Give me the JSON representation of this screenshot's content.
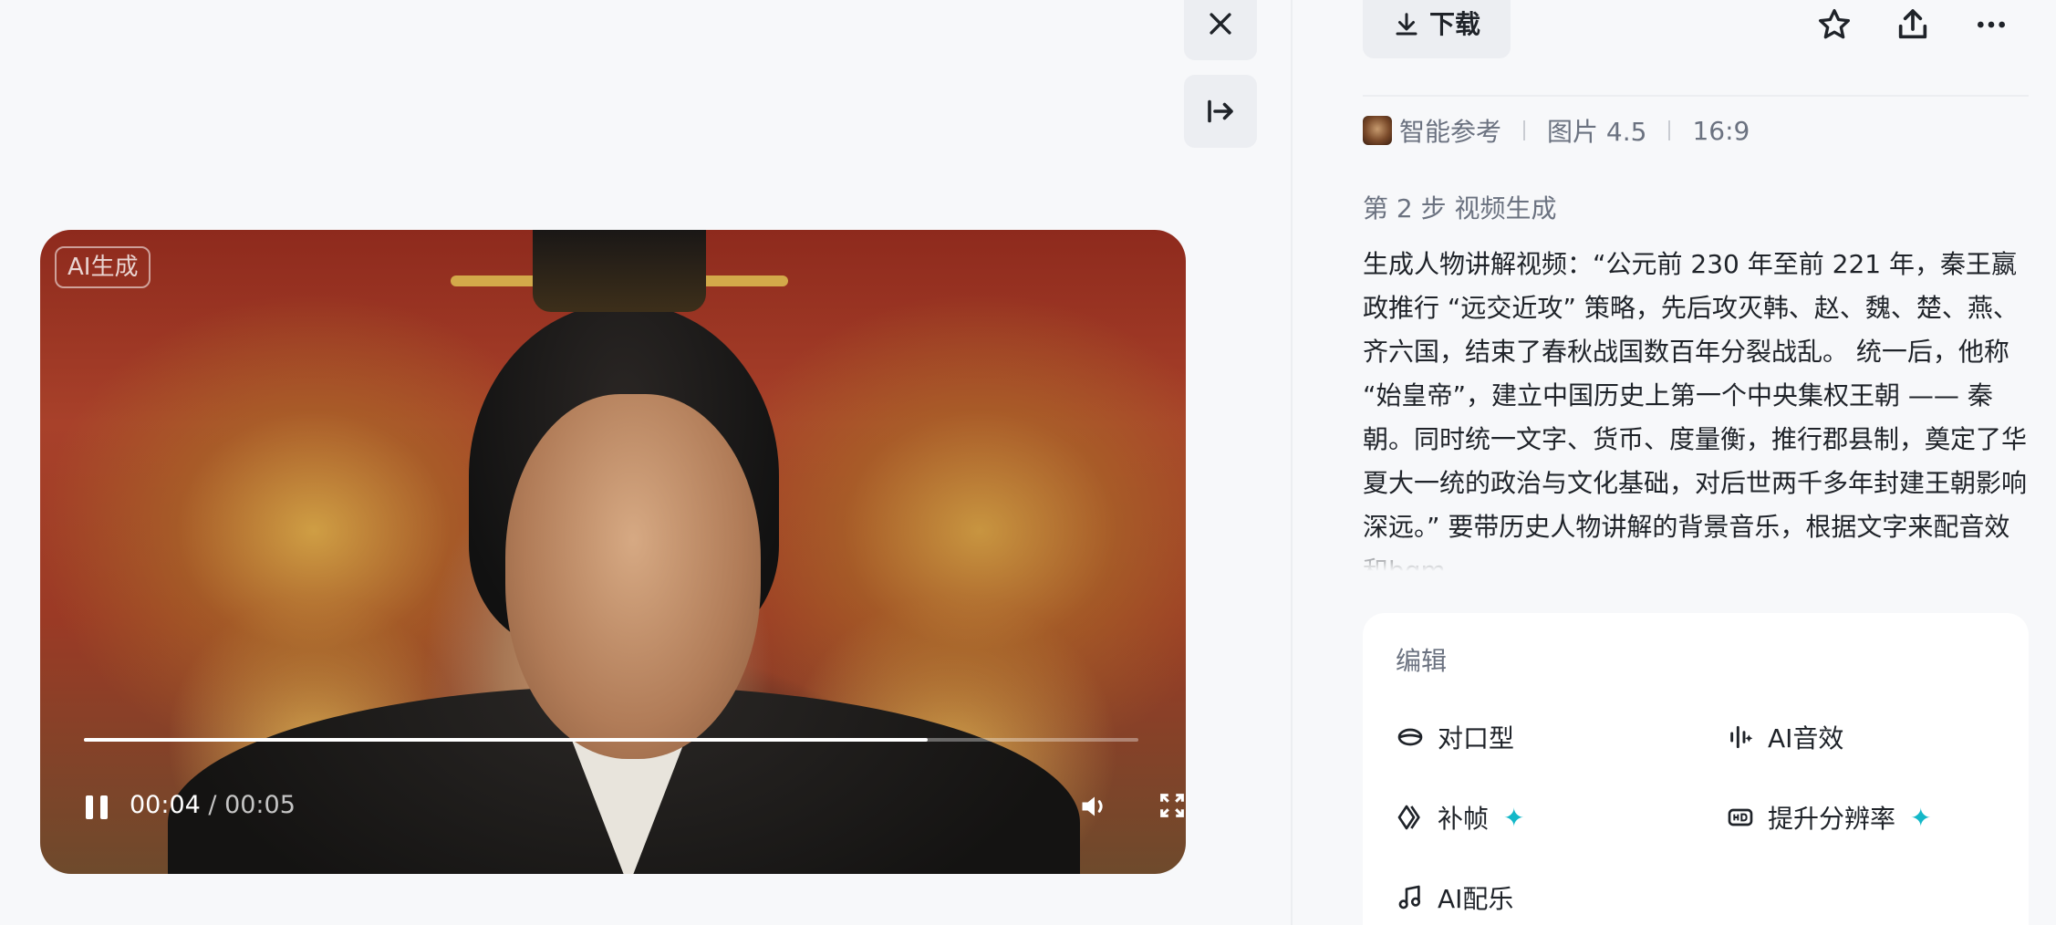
{
  "video": {
    "badge": "AI生成",
    "current_time": "00:04",
    "separator": " / ",
    "duration": "00:05",
    "progress": 0.8
  },
  "toolbar": {
    "download_label": "下载",
    "icons": [
      "close-icon",
      "collapse-panel-icon",
      "download-icon",
      "star-icon",
      "share-icon",
      "more-icon"
    ]
  },
  "meta": {
    "reference": "智能参考",
    "model": "图片 4.5",
    "ratio": "16:9"
  },
  "step": {
    "title": "第 2 步 视频生成",
    "description": "生成人物讲解视频：“公元前 230 年至前 221 年，秦王嬴政推行 “远交近攻” 策略，先后攻灭韩、赵、魏、楚、燕、齐六国，结束了春秋战国数百年分裂战乱。 统一后，他称 “始皇帝”，建立中国历史上第一个中央集权王朝 —— 秦朝。同时统一文字、货币、度量衡，推行郡县制，奠定了华夏大一统的政治与文化基础，对后世两千多年封建王朝影响深远。” 要带历史人物讲解的背景音乐，根据文字来配音效和bgm"
  },
  "edit": {
    "title": "编辑",
    "items": [
      {
        "label": "对口型",
        "icon": "lip-sync-icon"
      },
      {
        "label": "AI音效",
        "icon": "sound-effect-icon"
      },
      {
        "label": "补帧",
        "icon": "frame-interpolation-icon",
        "sparkle": "✦"
      },
      {
        "label": "提升分辨率",
        "icon": "hd-icon",
        "sparkle": "✦"
      },
      {
        "label": "AI配乐",
        "icon": "music-note-icon"
      }
    ]
  },
  "colors": {
    "background": "#f7f8fa",
    "accent_sparkle": "#14b8c8",
    "text_primary": "#1f2329",
    "text_secondary": "#6b7280"
  }
}
